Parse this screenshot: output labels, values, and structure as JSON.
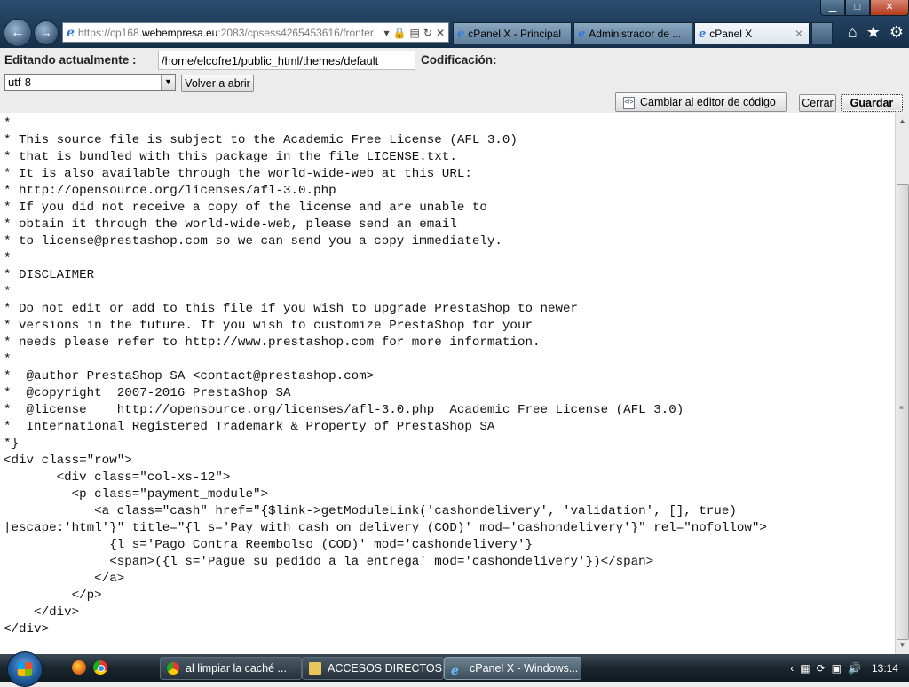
{
  "browser": {
    "url_prefix": "https://cp168.",
    "url_host": "webempresa.eu",
    "url_rest": ":2083/cpsess4265453616/fronter",
    "tabs": [
      {
        "label": "cPanel X - Principal"
      },
      {
        "label": "Administrador de ..."
      },
      {
        "label": "cPanel X",
        "active": true
      }
    ],
    "window_controls": {
      "minimize": "▁",
      "maximize": "□",
      "close": "✕"
    }
  },
  "editor": {
    "editing_label": "Editando actualmente :",
    "path_value": "/home/elcofre1/public_html/themes/default",
    "encoding_label": "Codificación:",
    "encoding_value": "utf-8",
    "reopen_button": "Volver a abrir",
    "switch_editor_button": "Cambiar al editor de código",
    "close_button": "Cerrar",
    "save_button": "Guardar",
    "code": "*\n* This source file is subject to the Academic Free License (AFL 3.0)\n* that is bundled with this package in the file LICENSE.txt.\n* It is also available through the world-wide-web at this URL:\n* http://opensource.org/licenses/afl-3.0.php\n* If you did not receive a copy of the license and are unable to\n* obtain it through the world-wide-web, please send an email\n* to license@prestashop.com so we can send you a copy immediately.\n*\n* DISCLAIMER\n*\n* Do not edit or add to this file if you wish to upgrade PrestaShop to newer\n* versions in the future. If you wish to customize PrestaShop for your\n* needs please refer to http://www.prestashop.com for more information.\n*\n*  @author PrestaShop SA <contact@prestashop.com>\n*  @copyright  2007-2016 PrestaShop SA\n*  @license    http://opensource.org/licenses/afl-3.0.php  Academic Free License (AFL 3.0)\n*  International Registered Trademark & Property of PrestaShop SA\n*}\n<div class=\"row\">\n       <div class=\"col-xs-12\">\n         <p class=\"payment_module\">\n            <a class=\"cash\" href=\"{$link->getModuleLink('cashondelivery', 'validation', [], true)\n|escape:'html'}\" title=\"{l s='Pay with cash on delivery (COD)' mod='cashondelivery'}\" rel=\"nofollow\">\n              {l s='Pago Contra Reembolso (COD)' mod='cashondelivery'}\n              <span>({l s='Pague su pedido a la entrega' mod='cashondelivery'})</span>\n            </a>\n         </p>\n    </div>\n</div>"
  },
  "taskbar": {
    "items": [
      {
        "label": "al limpiar la caché ..."
      },
      {
        "label": "ACCESOS DIRECTOS"
      },
      {
        "label": "cPanel X - Windows..."
      }
    ],
    "clock": "13:14"
  }
}
